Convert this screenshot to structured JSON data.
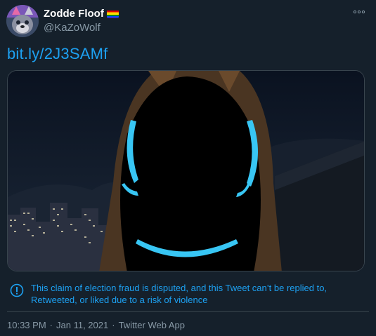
{
  "author": {
    "display_name": "Zodde Floof",
    "handle": "@KaZoWolf",
    "avatar_icon": "avatar-image",
    "badge_icon": "rainbow-flag-icon"
  },
  "tweet": {
    "link_text": "bit.ly/2J3SAMf",
    "more_icon": "more-options-icon"
  },
  "warning": {
    "icon": "exclamation-circle-icon",
    "text": "This claim of election fraud is disputed, and this Tweet can’t be replied to, Retweeted, or liked due to a risk of violence"
  },
  "meta": {
    "time": "10:33 PM",
    "separator1": "·",
    "date": "Jan 11, 2021",
    "separator2": "·",
    "source": "Twitter Web App"
  },
  "colors": {
    "background": "#15202b",
    "accent": "#1da1f2",
    "secondary_text": "#8899a6",
    "border": "#38444d"
  }
}
